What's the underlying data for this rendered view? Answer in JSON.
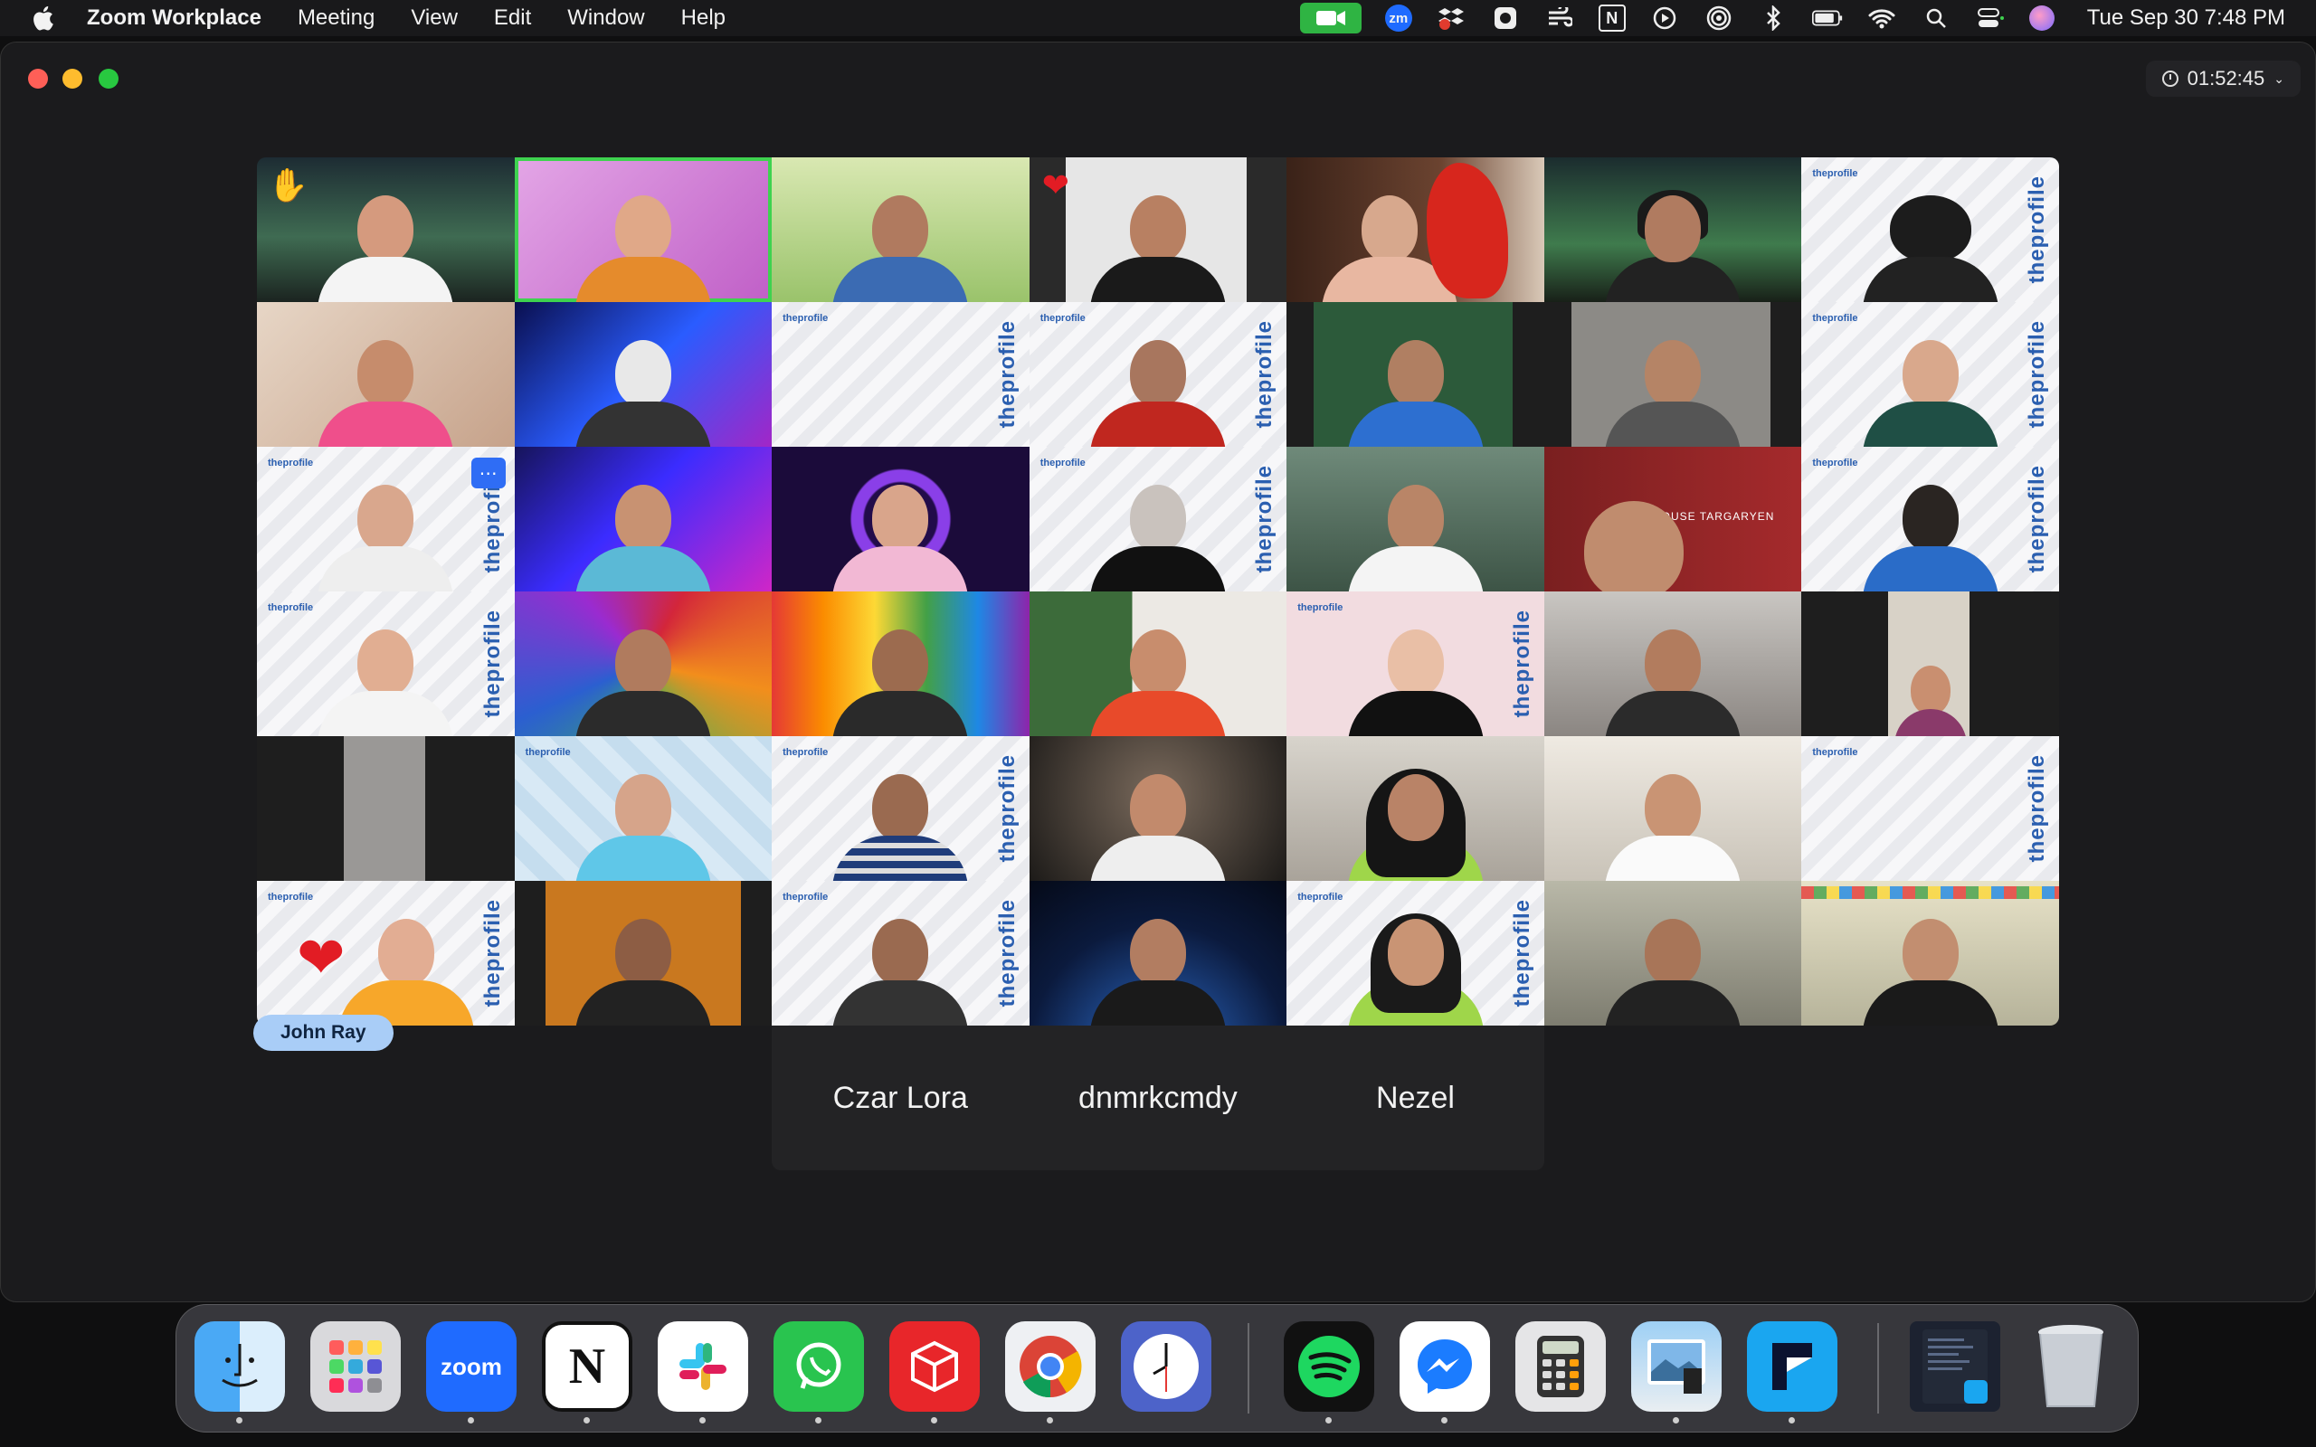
{
  "menubar": {
    "app_name": "Zoom Workplace",
    "menus": [
      "Meeting",
      "View",
      "Edit",
      "Window",
      "Help"
    ],
    "datetime": "Tue Sep 30  7:48 PM",
    "tray_icons": [
      "zoom-camera-icon",
      "zoom-icon",
      "dropbox-icon",
      "settings-icon",
      "wind-icon",
      "notion-icon",
      "play-icon",
      "airdrop-icon",
      "bluetooth-icon",
      "battery-icon",
      "wifi-icon",
      "search-icon",
      "control-center-icon",
      "user-avatar-icon"
    ],
    "zoom_badge": "zm",
    "notion_letter": "N",
    "dropbox_badge": "5"
  },
  "window": {
    "meeting_timer": "01:52:45"
  },
  "grid": {
    "brand_text": "theprofile",
    "tag_text": "HOUSE TARGARYEN"
  },
  "name_badge": "John Ray",
  "audio_only_names": [
    "Czar Lora",
    "dnmrkcmdy",
    "Nezel"
  ],
  "dock": {
    "apps": [
      "Finder",
      "Launchpad",
      "Zoom",
      "Notion",
      "Slack",
      "WhatsApp",
      "RedNote",
      "Chrome",
      "Clock",
      "Spotify",
      "Messenger",
      "Calculator",
      "Preview",
      "Framer",
      "Screenshot",
      "Trash"
    ],
    "zoom_label": "zoom",
    "notion_letter": "N"
  },
  "colors": {
    "active_speaker": "#3ed24f",
    "name_badge_bg": "#a9cdf7",
    "zoom_blue": "#1f6bff"
  }
}
